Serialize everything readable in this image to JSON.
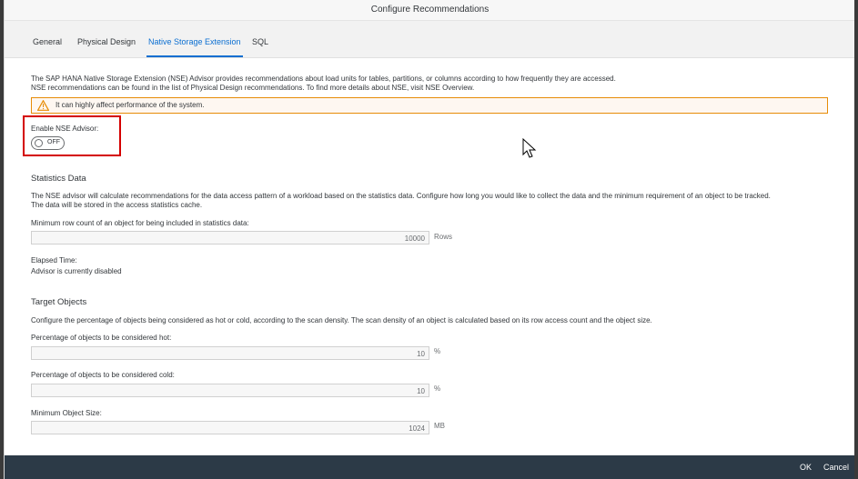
{
  "dialog": {
    "title": "Configure Recommendations",
    "tabs": [
      {
        "label": "General"
      },
      {
        "label": "Physical Design"
      },
      {
        "label": "Native Storage Extension"
      },
      {
        "label": "SQL"
      }
    ],
    "active_tab": "Native Storage Extension"
  },
  "intro": {
    "line1": "The SAP HANA Native Storage Extension (NSE) Advisor provides recommendations about load units for tables, partitions, or columns according to how frequently they are accessed.",
    "line2": "NSE recommendations can be found in the list of Physical Design recommendations. To find more details about NSE, visit NSE Overview."
  },
  "warning": {
    "message": "It can highly affect performance of the system."
  },
  "nse_toggle": {
    "label": "Enable NSE Advisor:",
    "state": "OFF"
  },
  "statistics": {
    "heading": "Statistics Data",
    "desc1": "The NSE advisor will calculate recommendations for the data access pattern of a workload based on the statistics data. Configure how long you would like to collect the data and the minimum requirement of an object to be tracked.",
    "desc2": "The data will be stored in the access statistics cache.",
    "min_row_label": "Minimum row count of an object for being included in statistics data:",
    "min_row_value": "10000",
    "min_row_unit": "Rows",
    "elapsed_label": "Elapsed Time:",
    "elapsed_value": "Advisor is currently disabled"
  },
  "target": {
    "heading": "Target Objects",
    "desc": "Configure the percentage of objects being considered as hot or cold, according to the scan density. The scan density of an object is calculated based on its row access count and the object size.",
    "hot_label": "Percentage of objects to be considered hot:",
    "hot_value": "10",
    "hot_unit": "%",
    "cold_label": "Percentage of objects to be considered cold:",
    "cold_value": "10",
    "cold_unit": "%",
    "size_label": "Minimum Object Size:",
    "size_value": "1024",
    "size_unit": "MB"
  },
  "footer": {
    "ok": "OK",
    "cancel": "Cancel"
  },
  "colors": {
    "accent": "#0a6ed1",
    "warning_border": "#e78c07",
    "highlight": "#d40000",
    "footer_bg": "#2c3a47"
  }
}
